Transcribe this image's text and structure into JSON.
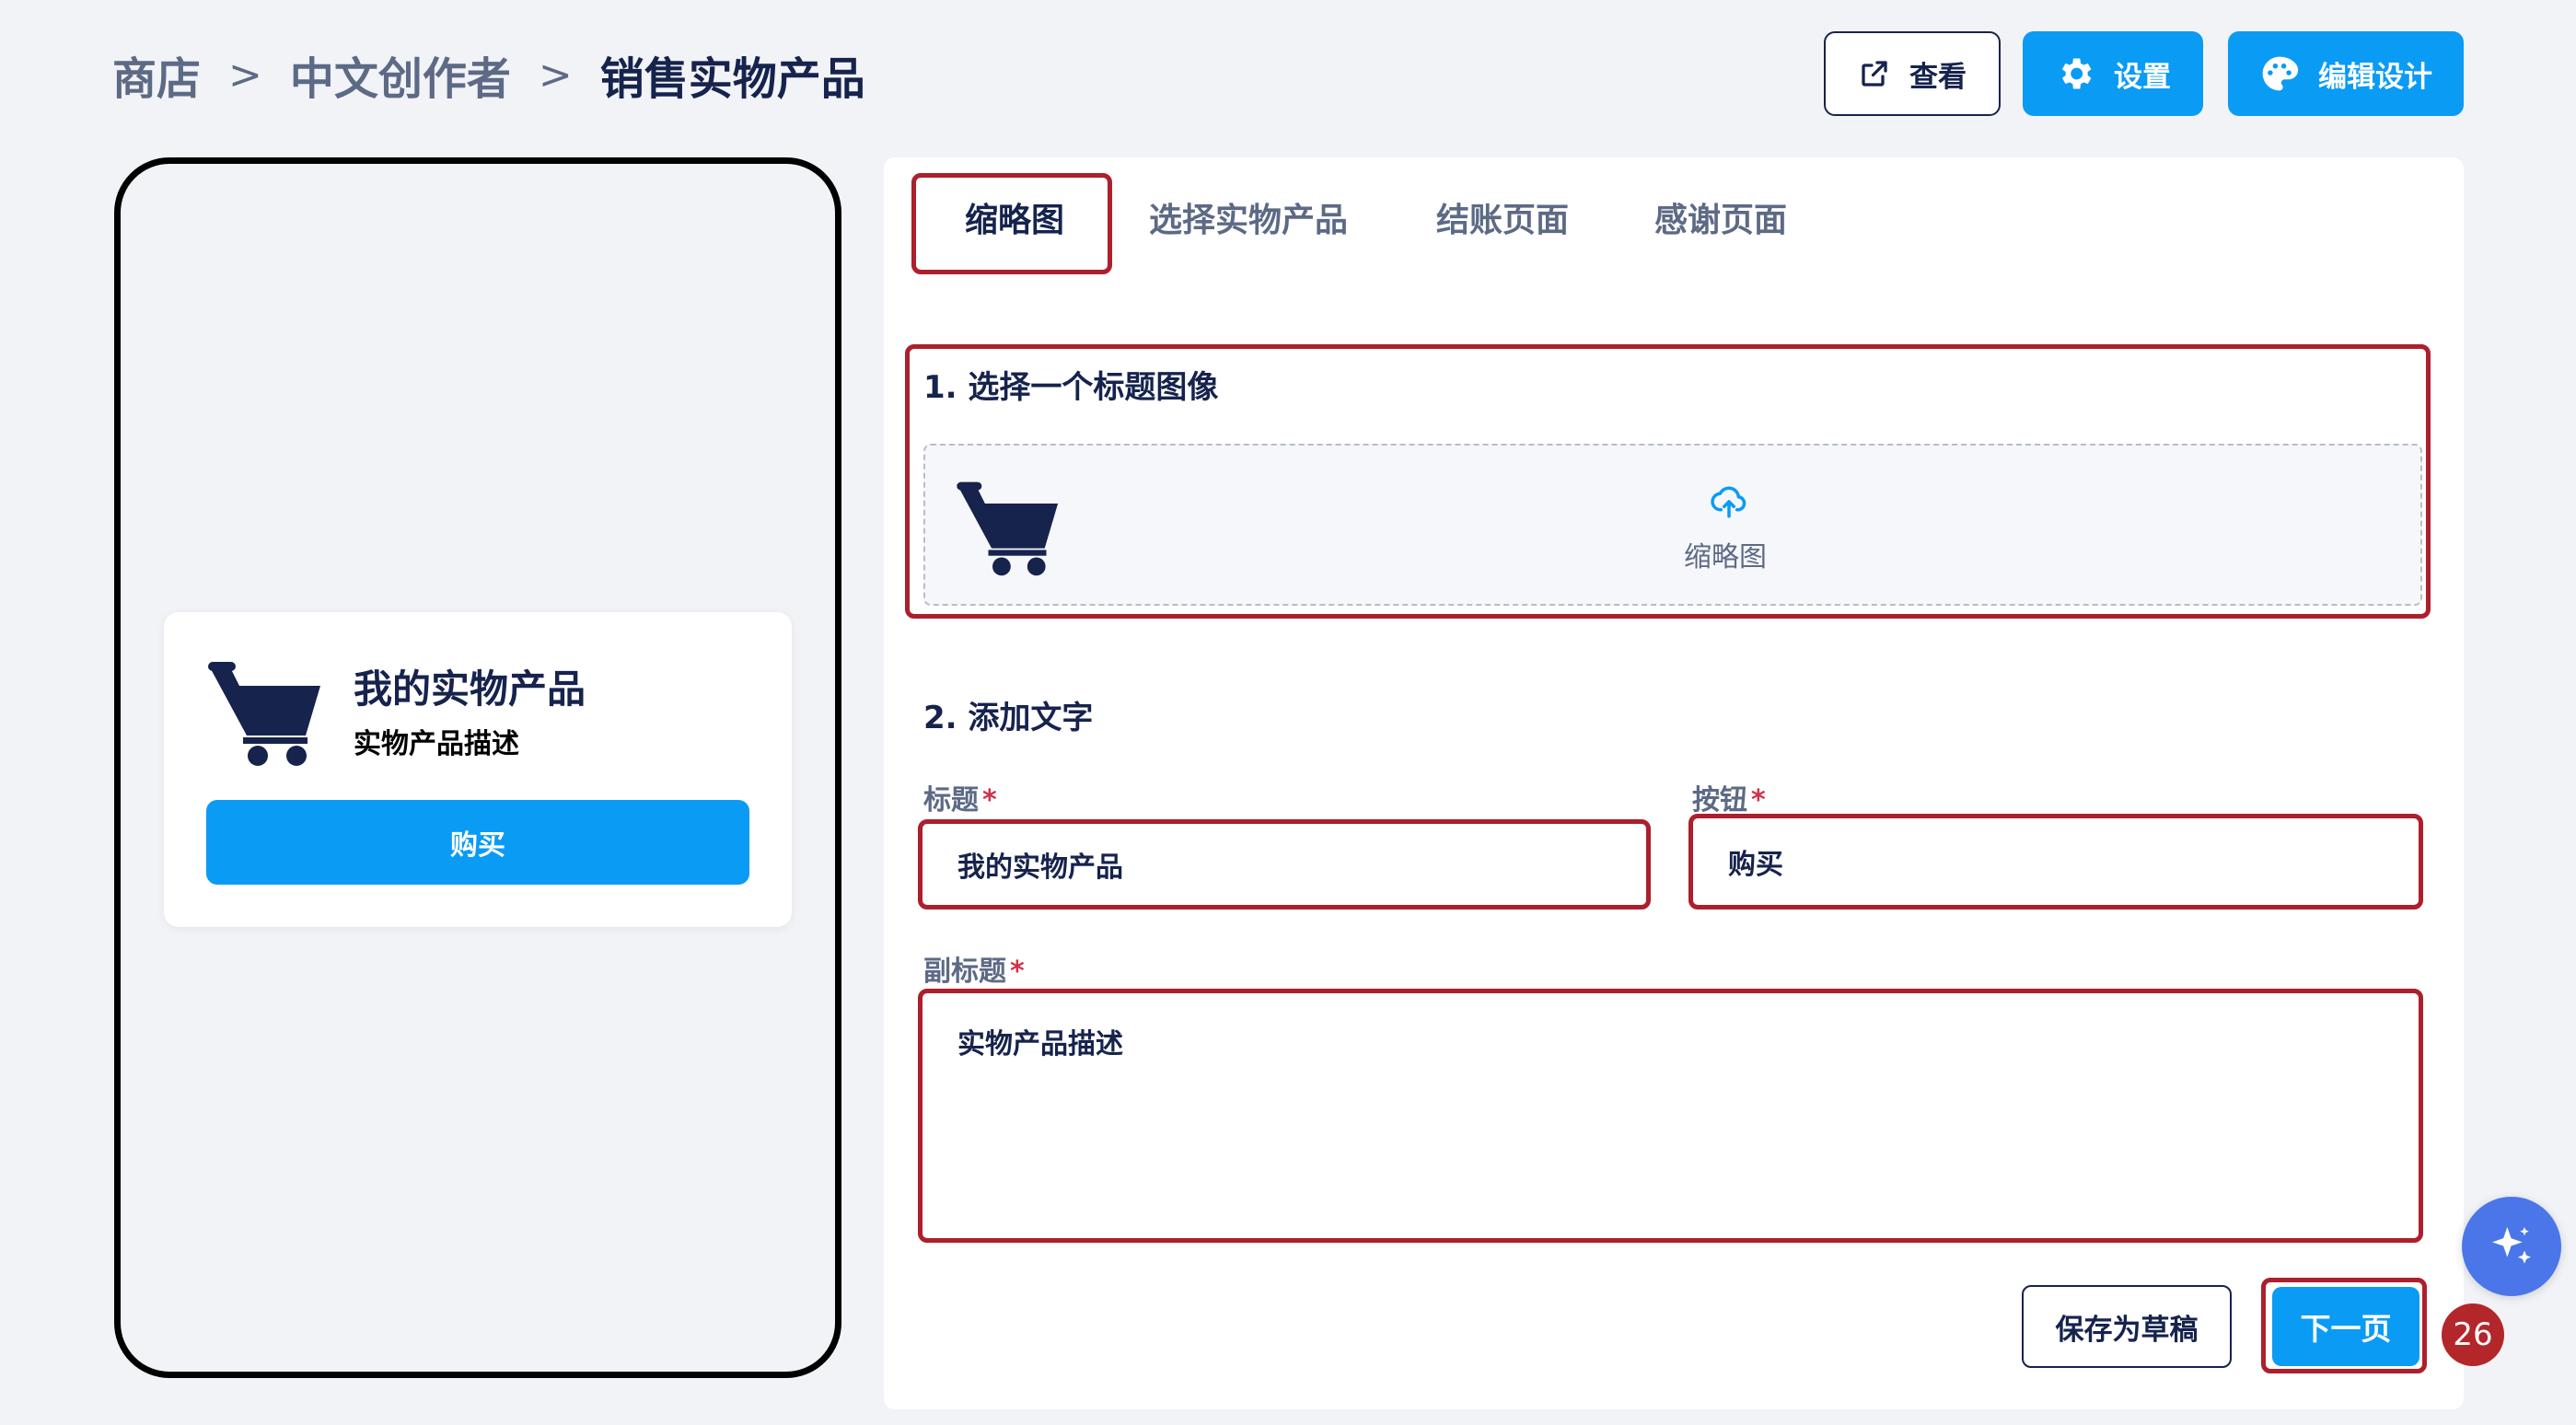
{
  "breadcrumb": {
    "items": [
      "商店",
      "中文创作者",
      "销售实物产品"
    ],
    "separator": ">"
  },
  "header": {
    "view_label": "查看",
    "settings_label": "设置",
    "design_label": "编辑设计"
  },
  "preview": {
    "title": "我的实物产品",
    "subtitle": "实物产品描述",
    "button_label": "购买"
  },
  "tabs": [
    {
      "label": "缩略图",
      "active": true
    },
    {
      "label": "选择实物产品",
      "active": false
    },
    {
      "label": "结账页面",
      "active": false
    },
    {
      "label": "感谢页面",
      "active": false
    }
  ],
  "section1": {
    "title": "1. 选择一个标题图像",
    "upload_label": "缩略图"
  },
  "section2": {
    "title": "2. 添加文字",
    "title_label": "标题",
    "title_value": "我的实物产品",
    "button_label": "按钮",
    "button_value": "购买",
    "subtitle_label": "副标题",
    "subtitle_value": "实物产品描述",
    "required_mark": "*"
  },
  "footer": {
    "draft_label": "保存为草稿",
    "next_label": "下一页",
    "badge_count": "26"
  },
  "colors": {
    "accent": "#0a9bf5",
    "navy": "#16234d",
    "highlight": "#ad1f2c"
  },
  "icons": [
    "external-link-icon",
    "gear-icon",
    "palette-icon",
    "cart-icon",
    "upload-cloud-icon",
    "sparkle-icon"
  ]
}
